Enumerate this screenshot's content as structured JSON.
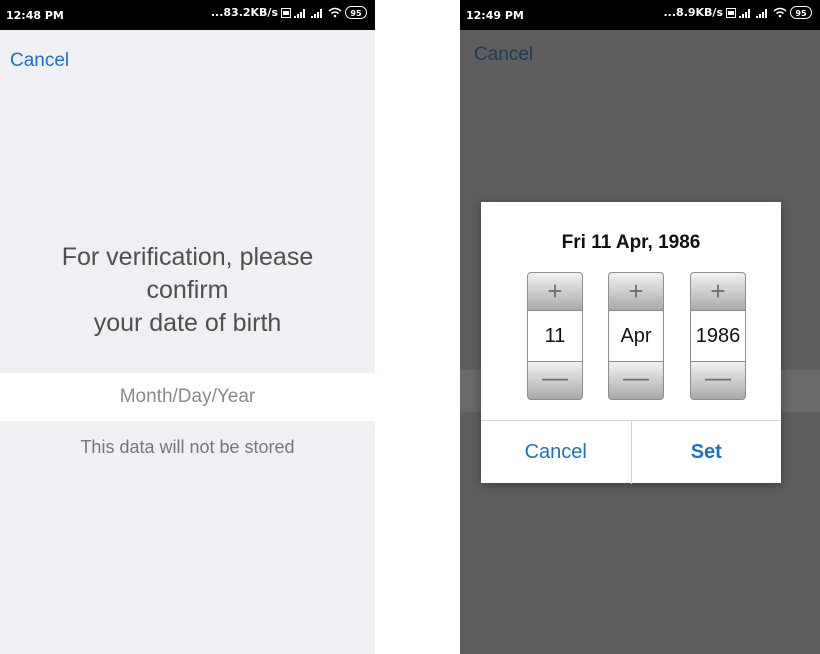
{
  "left_screen": {
    "status": {
      "time": "12:48 PM",
      "speed": "...83.2KB/s",
      "battery": "95"
    },
    "cancel_label": "Cancel",
    "prompt": "For verification, please\nconfirm\nyour date of birth",
    "date_field_placeholder": "Month/Day/Year",
    "note": "This data will not be stored"
  },
  "right_screen": {
    "status": {
      "time": "12:49 PM",
      "speed": "...8.9KB/s",
      "battery": "95"
    },
    "cancel_label": "Cancel",
    "dialog": {
      "title": "Fri 11 Apr, 1986",
      "pickers": [
        {
          "value": "11",
          "plus": "+",
          "minus": "—"
        },
        {
          "value": "Apr",
          "plus": "+",
          "minus": "—"
        },
        {
          "value": "1986",
          "plus": "+",
          "minus": "—"
        }
      ],
      "cancel_label": "Cancel",
      "set_label": "Set"
    }
  },
  "colors": {
    "accent": "#1a72c8",
    "overlay": "#5e5e5e",
    "background": "#efeff4"
  }
}
